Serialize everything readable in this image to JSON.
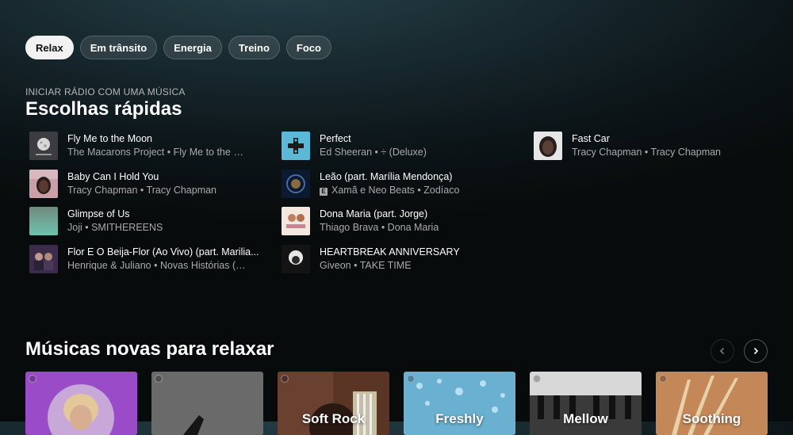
{
  "chips": [
    "Relax",
    "Em trânsito",
    "Energia",
    "Treino",
    "Foco"
  ],
  "quick_picks": {
    "overline": "INICIAR RÁDIO COM UMA MÚSICA",
    "title": "Escolhas rápidas",
    "columns": [
      [
        {
          "title": "Fly Me to the Moon",
          "subtitle": "The Macarons Project • Fly Me to the Moon",
          "explicit": false
        },
        {
          "title": "Baby Can I Hold You",
          "subtitle": "Tracy Chapman • Tracy Chapman",
          "explicit": false
        },
        {
          "title": "Glimpse of Us",
          "subtitle": "Joji • SMITHEREENS",
          "explicit": false
        },
        {
          "title": "Flor E O Beija-Flor (Ao Vivo) (part. Marilia...",
          "subtitle": "Henrique & Juliano • Novas Histórias (Ao ...",
          "explicit": false
        }
      ],
      [
        {
          "title": "Perfect",
          "subtitle": "Ed Sheeran • ÷ (Deluxe)",
          "explicit": false
        },
        {
          "title": "Leão (part. Marília Mendonça)",
          "subtitle": "Xamã e Neo Beats • Zodíaco",
          "explicit": true
        },
        {
          "title": "Dona Maria (part. Jorge)",
          "subtitle": "Thiago Brava • Dona Maria",
          "explicit": false
        },
        {
          "title": "HEARTBREAK ANNIVERSARY",
          "subtitle": "Giveon • TAKE TIME",
          "explicit": false
        }
      ],
      [
        {
          "title": "Fast Car",
          "subtitle": "Tracy Chapman • Tracy Chapman",
          "explicit": false
        }
      ]
    ]
  },
  "new_relax": {
    "title": "Músicas novas para relaxar",
    "cards": [
      {
        "label": ""
      },
      {
        "label": ""
      },
      {
        "label": "Soft Rock"
      },
      {
        "label": "Freshly"
      },
      {
        "label": "Mellow"
      },
      {
        "label": "Soothing"
      }
    ]
  },
  "icons": {
    "prev": "chevron-left-icon",
    "next": "chevron-right-icon"
  }
}
